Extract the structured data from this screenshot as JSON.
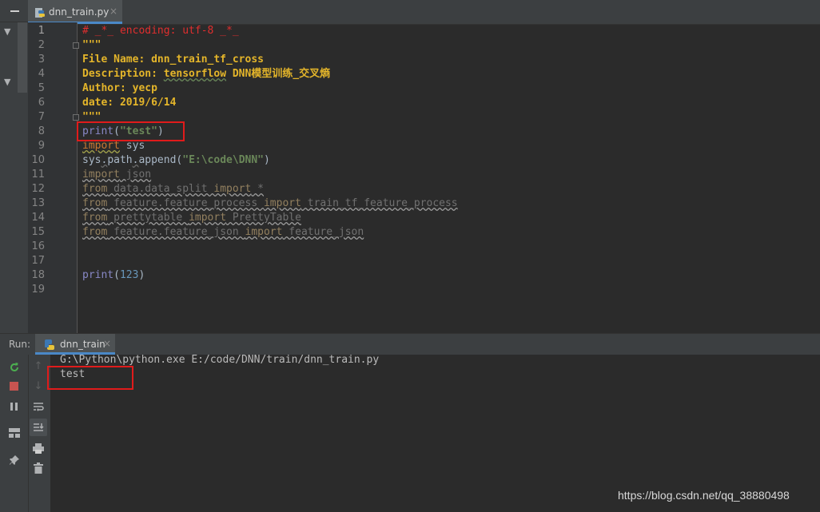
{
  "editor": {
    "tab_label": "dnn_train.py",
    "tab_close": "×",
    "line_numbers": [
      "1",
      "2",
      "3",
      "4",
      "5",
      "6",
      "7",
      "8",
      "9",
      "10",
      "11",
      "12",
      "13",
      "14",
      "15",
      "16",
      "17",
      "18",
      "19"
    ]
  },
  "code": {
    "l1": "# _*_ encoding: utf-8 _*_",
    "l2": "\"\"\"",
    "l3": "File Name: dnn_train_tf_cross",
    "l4a": "Description: ",
    "l4b": "tensorflow",
    "l4c": " DNN模型训练_交叉熵",
    "l5": "Author: yecp",
    "l6": "date: 2019/6/14",
    "l7": "\"\"\"",
    "l8a": "print",
    "l8b": "(",
    "l8c": "\"test\"",
    "l8d": ")",
    "l9a": "import",
    "l9b": " sys",
    "l10a": "sys",
    "l10b": ".",
    "l10c": "path",
    "l10d": ".",
    "l10e": "append(",
    "l10f": "\"E:\\code\\DNN\"",
    "l10g": ")",
    "l11a": "import",
    "l11b": " json",
    "l12a": "from",
    "l12b": " data.data_split ",
    "l12c": "import",
    "l12d": " *",
    "l13a": "from",
    "l13b": " feature.feature_process ",
    "l13c": "import",
    "l13d": " train_tf_feature_process",
    "l14a": "from",
    "l14b": " prettytable ",
    "l14c": "import",
    "l14d": " PrettyTable",
    "l15a": "from",
    "l15b": " feature.feature_json ",
    "l15c": "import",
    "l15d": " feature_json",
    "l18a": "print",
    "l18b": "(",
    "l18c": "123",
    "l18d": ")"
  },
  "run": {
    "label": "Run:",
    "tab_label": "dnn_train",
    "tab_close": "×",
    "output": [
      "G:\\Python\\python.exe E:/code/DNN/train/dnn_train.py",
      "test"
    ]
  },
  "icons": {
    "minimize": "minimize-icon",
    "python_file": "python-file-icon",
    "rerun": "rerun-icon",
    "stop": "stop-icon",
    "pause": "pause-icon",
    "layout": "layout-icon",
    "pin": "pin-icon",
    "up": "arrow-up-icon",
    "down": "arrow-down-icon",
    "wrap": "soft-wrap-icon",
    "scroll_end": "scroll-to-end-icon",
    "print": "print-icon",
    "trash": "trash-icon"
  },
  "colors": {
    "highlight_box": "#e01b1b",
    "docstring": "#e4b52a",
    "comment": "#e02e2e",
    "keyword": "#cc7832",
    "string": "#6a8759",
    "number": "#6897bb",
    "builtin": "#8888c6",
    "rerun": "#4caf50",
    "stop": "#c75450"
  },
  "watermark": "https://blog.csdn.net/qq_38880498"
}
